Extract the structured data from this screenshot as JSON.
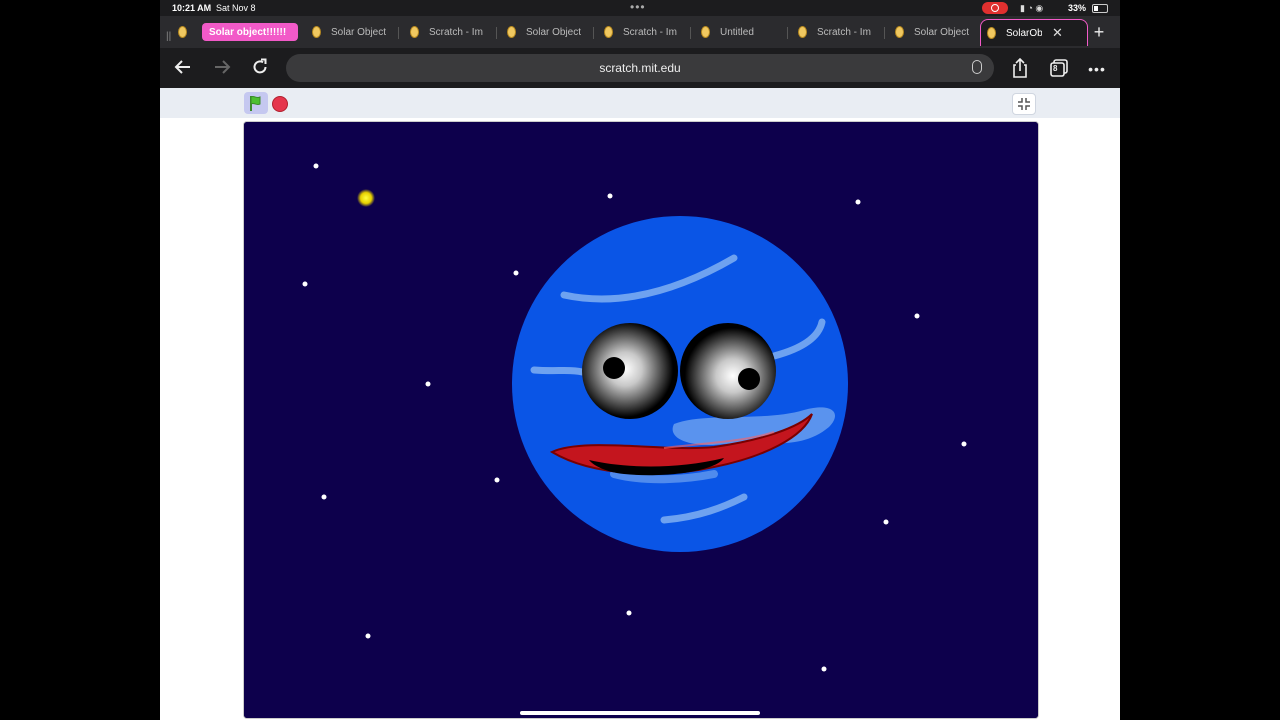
{
  "status_bar": {
    "time": "10:21 AM",
    "date": "Sat Nov 8",
    "battery": "33%"
  },
  "tabs": [
    {
      "label": "Solar object!!!!!!",
      "style": "pink"
    },
    {
      "label": "Solar Object"
    },
    {
      "label": "Scratch - Im"
    },
    {
      "label": "Solar Object"
    },
    {
      "label": "Scratch - Im"
    },
    {
      "label": "Untitled"
    },
    {
      "label": "Scratch - Im"
    },
    {
      "label": "Solar Object"
    },
    {
      "label": "SolarOb",
      "active": true
    }
  ],
  "toolbar": {
    "url": "scratch.mit.edu",
    "tab_count": "8"
  },
  "stage": {
    "background": "#0d004c",
    "planet_color": "#0a55e6",
    "character": "planet-face-sprite"
  },
  "icons": {
    "back": "back-arrow-icon",
    "forward": "forward-arrow-icon",
    "reload": "reload-icon",
    "share": "share-icon",
    "tabs": "tabs-icon",
    "more": "more-icon",
    "green_flag": "green-flag-icon",
    "stop": "stop-icon",
    "fullscreen": "exit-fullscreen-icon"
  }
}
